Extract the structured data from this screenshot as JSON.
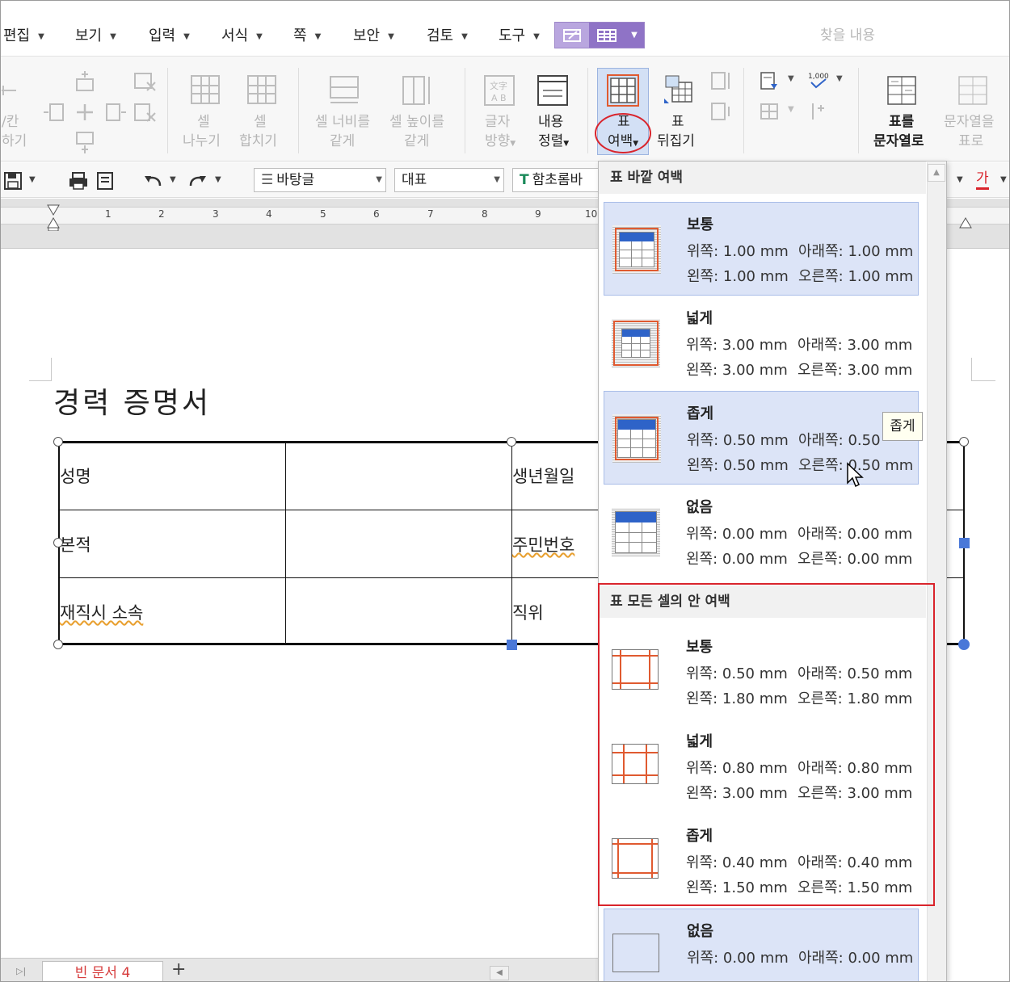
{
  "menu": [
    {
      "label": "편집"
    },
    {
      "label": "보기"
    },
    {
      "label": "입력"
    },
    {
      "label": "서식"
    },
    {
      "label": "쪽"
    },
    {
      "label": "보안"
    },
    {
      "label": "검토"
    },
    {
      "label": "도구"
    }
  ],
  "search": {
    "placeholder": "찾을 내용"
  },
  "ribbon": {
    "partial_left_1": "/칸",
    "partial_left_2": "하기",
    "split_cell_1": "셀",
    "split_cell_2": "나누기",
    "merge_cell_1": "셀",
    "merge_cell_2": "합치기",
    "eq_width_1": "셀 너비를",
    "eq_width_2": "같게",
    "eq_height_1": "셀 높이를",
    "eq_height_2": "같게",
    "text_dir_1": "글자",
    "text_dir_2": "방향",
    "align_1": "내용",
    "align_2": "정렬",
    "margin_1": "표",
    "margin_2": "여백",
    "flip_1": "표",
    "flip_2": "뒤집기",
    "tbl2txt_1": "표를",
    "tbl2txt_2": "문자열로",
    "txt2tbl_1": "문자열을",
    "txt2tbl_2": "표로"
  },
  "toolbar2": {
    "style": "바탕글",
    "font_group": "대표",
    "font": "함초롬바",
    "char_color": "가"
  },
  "ruler": {
    "numbers": [
      "1",
      "2",
      "3",
      "4",
      "5",
      "6",
      "7",
      "8",
      "9",
      "10"
    ]
  },
  "document": {
    "title": "경력 증명서",
    "rows": [
      {
        "label": "성명",
        "label2": "생년월일"
      },
      {
        "label": "본적",
        "label2": "주민번호"
      },
      {
        "label": "재직시 소속",
        "label2": "직위"
      }
    ]
  },
  "bottom": {
    "tab": "빈 문서 4",
    "add": "+"
  },
  "dropdown": {
    "outer_header": "표 바깥 여백",
    "outer": [
      {
        "name": "보통",
        "top": "위쪽: 1.00 mm",
        "bottom": "아래쪽: 1.00 mm",
        "left": "왼쪽: 1.00 mm",
        "right": "오른쪽: 1.00 mm"
      },
      {
        "name": "넓게",
        "top": "위쪽: 3.00 mm",
        "bottom": "아래쪽: 3.00 mm",
        "left": "왼쪽: 3.00 mm",
        "right": "오른쪽: 3.00 mm"
      },
      {
        "name": "좁게",
        "top": "위쪽: 0.50 mm",
        "bottom": "아래쪽: 0.50",
        "left": "왼쪽: 0.50 mm",
        "right": "오른쪽: 0.50 mm"
      },
      {
        "name": "없음",
        "top": "위쪽: 0.00 mm",
        "bottom": "아래쪽: 0.00 mm",
        "left": "왼쪽: 0.00 mm",
        "right": "오른쪽: 0.00 mm"
      }
    ],
    "inner_header": "표 모든 셀의 안 여백",
    "inner": [
      {
        "name": "보통",
        "top": "위쪽: 0.50 mm",
        "bottom": "아래쪽: 0.50 mm",
        "left": "왼쪽: 1.80 mm",
        "right": "오른쪽: 1.80 mm"
      },
      {
        "name": "넓게",
        "top": "위쪽: 0.80 mm",
        "bottom": "아래쪽: 0.80 mm",
        "left": "왼쪽: 3.00 mm",
        "right": "오른쪽: 3.00 mm"
      },
      {
        "name": "좁게",
        "top": "위쪽: 0.40 mm",
        "bottom": "아래쪽: 0.40 mm",
        "left": "왼쪽: 1.50 mm",
        "right": "오른쪽: 1.50 mm"
      },
      {
        "name": "없음",
        "top": "위쪽: 0.00 mm",
        "bottom": "아래쪽: 0.00 mm",
        "left": "",
        "right": ""
      }
    ],
    "tooltip": "좁게"
  }
}
